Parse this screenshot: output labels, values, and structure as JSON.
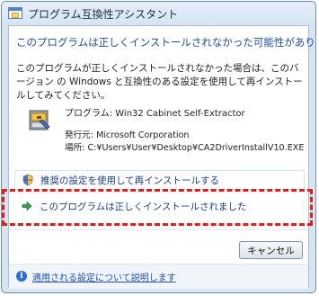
{
  "window": {
    "title": "プログラム互換性アシスタント"
  },
  "main": {
    "heading": "このプログラムは正しくインストールされなかった可能性があります",
    "description": "このプログラムが正しくインストールされなかった場合は、このバージョン の Windows と互換性のある設定を使用して再インストールしてみてください。",
    "program_label": "プログラム: Win32 Cabinet Self-Extractor",
    "publisher": "発行元: Microsoft Corporation",
    "location": "場所: C:¥Users¥User¥Desktop¥CA2DriverInstallV10.EXE"
  },
  "actions": [
    {
      "label": "推奨の設定を使用して再インストールする",
      "icon": "shield-icon"
    },
    {
      "label": "このプログラムは正しくインストールされました",
      "icon": "green-arrow-icon"
    }
  ],
  "buttons": {
    "cancel": "キャンセル"
  },
  "footer": {
    "link": "適用される設定について説明します"
  },
  "colors": {
    "heading": "#1e4ea8",
    "link": "#1f4fb7",
    "highlight": "#e31b1b"
  }
}
